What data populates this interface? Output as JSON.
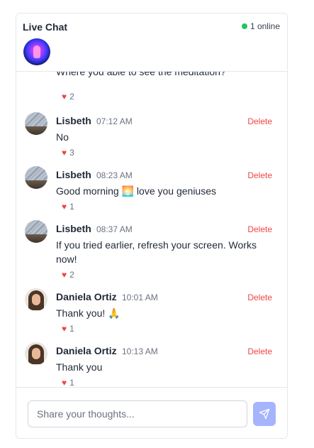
{
  "header": {
    "title": "Live Chat",
    "online_text": "1 online",
    "online_color": "#22c55e"
  },
  "messages": [
    {
      "author": "",
      "time": "",
      "text": "Where you able to see the meditation?",
      "likes": "2",
      "delete_label": ""
    },
    {
      "author": "Lisbeth",
      "time": "07:12 AM",
      "text": "No",
      "likes": "3",
      "delete_label": "Delete"
    },
    {
      "author": "Lisbeth",
      "time": "08:23 AM",
      "text": "Good morning 🌅 love you geniuses",
      "likes": "1",
      "delete_label": "Delete"
    },
    {
      "author": "Lisbeth",
      "time": "08:37 AM",
      "text": "If you tried earlier, refresh your screen. Works now!",
      "likes": "2",
      "delete_label": "Delete"
    },
    {
      "author": "Daniela Ortiz",
      "time": "10:01 AM",
      "text": "Thank you! 🙏",
      "likes": "1",
      "delete_label": "Delete"
    },
    {
      "author": "Daniela Ortiz",
      "time": "10:13 AM",
      "text": "Thank you",
      "likes": "1",
      "delete_label": "Delete"
    }
  ],
  "composer": {
    "placeholder": "Share your thoughts...",
    "send_icon": "paper-plane-icon",
    "send_color": "#a5b4fc"
  },
  "colors": {
    "delete": "#ef4444",
    "heart": "#ef4444",
    "border": "#e5e7eb"
  }
}
